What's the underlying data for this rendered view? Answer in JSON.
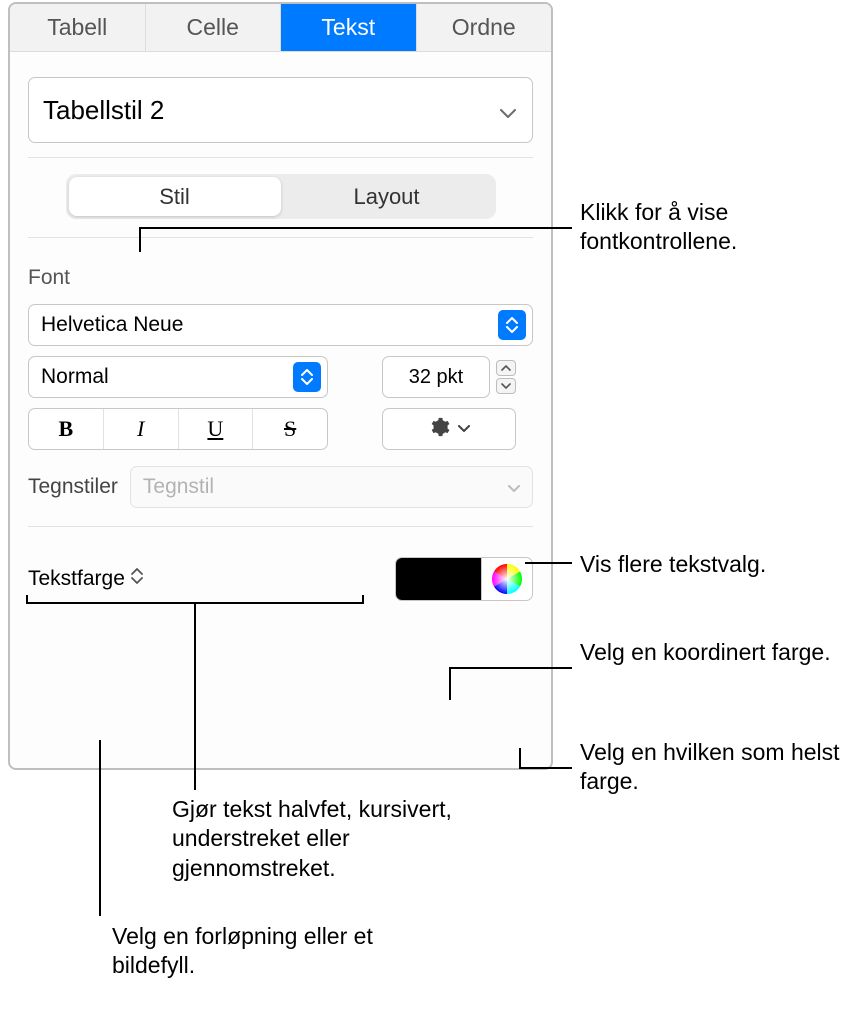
{
  "tabs": {
    "tabell": "Tabell",
    "celle": "Celle",
    "tekst": "Tekst",
    "ordne": "Ordne"
  },
  "stylePopup": "Tabellstil 2",
  "segment": {
    "stil": "Stil",
    "layout": "Layout"
  },
  "fontSection": {
    "label": "Font",
    "family": "Helvetica Neue",
    "style": "Normal",
    "size": "32 pkt"
  },
  "bius": {
    "bold": "B",
    "italic": "I",
    "underline": "U",
    "strike": "S"
  },
  "charStyle": {
    "label": "Tegnstiler",
    "placeholder": "Tegnstil"
  },
  "textColor": {
    "label": "Tekstfarge",
    "swatch": "#000000"
  },
  "callouts": {
    "fontControls": "Klikk for å vise fontkontrollene.",
    "moreTextOptions": "Vis flere tekstvalg.",
    "coordinatedColor": "Velg en koordinert farge.",
    "anyColor": "Velg en hvilken som helst farge.",
    "bius": "Gjør tekst halvfet, kursivert, understreket eller gjennomstreket.",
    "gradientFill": "Velg en forløpning eller et bildefyll."
  }
}
